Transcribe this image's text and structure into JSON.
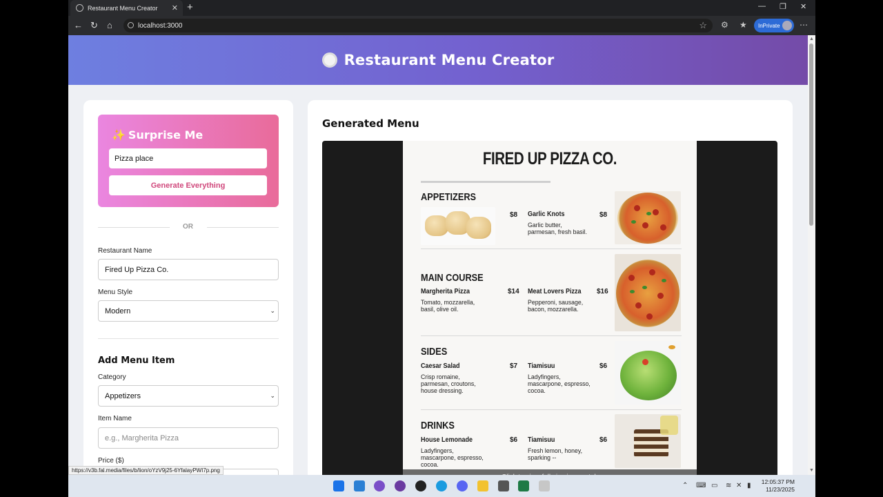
{
  "browser": {
    "tab_title": "Restaurant Menu Creator",
    "url": "localhost:3000",
    "inprivate_label": "InPrivate",
    "status_url": "https://v3b.fal.media/files/b/lion/oYzV9j25-6YfalayPWI7p.png"
  },
  "header": {
    "title": "Restaurant Menu Creator"
  },
  "surprise": {
    "title": "Surprise Me",
    "input_value": "Pizza place",
    "button_label": "Generate Everything"
  },
  "divider_or": "OR",
  "form": {
    "restaurant_name_label": "Restaurant Name",
    "restaurant_name_value": "Fired Up Pizza Co.",
    "menu_style_label": "Menu Style",
    "menu_style_value": "Modern",
    "add_item_title": "Add Menu Item",
    "category_label": "Category",
    "category_value": "Appetizers",
    "item_name_label": "Item Name",
    "item_name_placeholder": "e.g., Margherita Pizza",
    "price_label": "Price ($)"
  },
  "preview": {
    "title": "Generated Menu",
    "caption": "Click to view full size in new tab",
    "menu": {
      "title": "FIRED UP PIZZA CO.",
      "sections": [
        {
          "name": "APPETIZERS",
          "items": [
            {
              "name": "Garlic Knots",
              "price": "$8",
              "desc": "Garlic butter, parmesan, fresh basil."
            }
          ],
          "left_price": "$8"
        },
        {
          "name": "MAIN COURSE",
          "items": [
            {
              "name": "Margherita Pizza",
              "price": "$14",
              "desc": "Tomato, mozzarella, basil, olive oil."
            },
            {
              "name": "Meat Lovers Pizza",
              "price": "$16",
              "desc": "Pepperoni, sausage, bacon, mozzarella."
            }
          ]
        },
        {
          "name": "SIDES",
          "items": [
            {
              "name": "Caesar Salad",
              "price": "$7",
              "desc": "Crisp romaine, parmesan, croutons, house dressing."
            },
            {
              "name": "Tiamisuu",
              "price": "$6",
              "desc": "Ladyfingers, mascarpone, espresso, cocoa."
            }
          ]
        },
        {
          "name": "DRINKS",
          "items": [
            {
              "name": "House Lemonade",
              "price": "$6",
              "desc": "Ladyfingers, mascarpone, espresso, cocoa."
            },
            {
              "name": "Tiamisuu",
              "price": "$6",
              "desc": "Fresh lemon, honey, sparking --"
            }
          ]
        }
      ]
    }
  },
  "clock": {
    "time": "12:05:37 PM",
    "date": "11/23/2025"
  }
}
